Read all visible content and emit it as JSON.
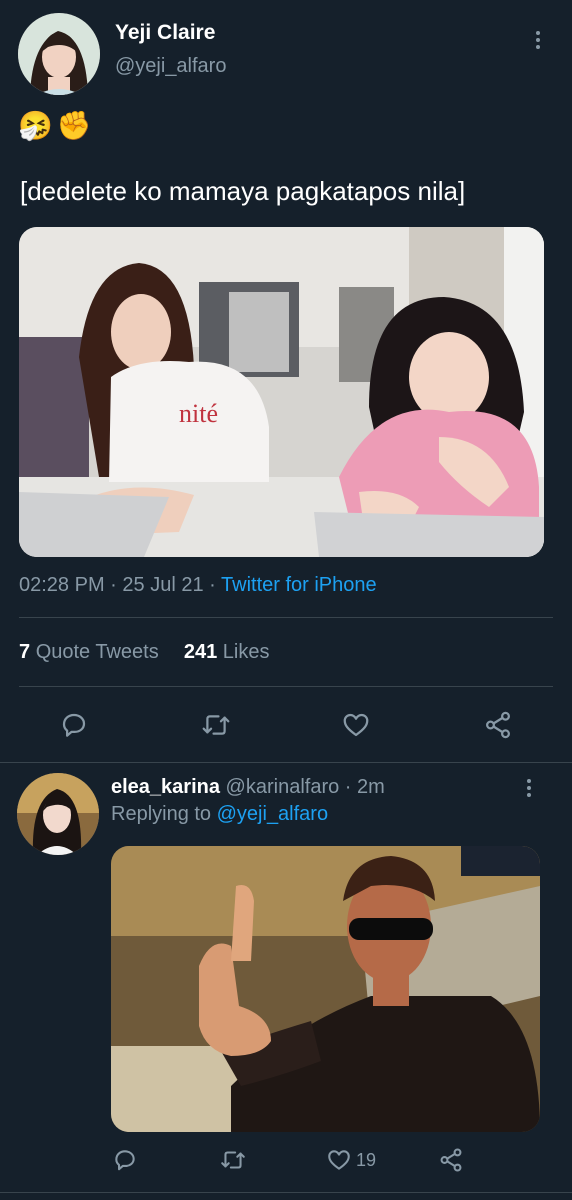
{
  "tweet": {
    "author_name": "Yeji Claire",
    "author_handle": "@yeji_alfaro",
    "emojis": "🤧✊",
    "text": "[dedelete ko mamaya pagkatapos nila]",
    "time": "02:28 PM",
    "date": "25 Jul 21",
    "separator": "·",
    "source": "Twitter for iPhone",
    "quote_count": "7",
    "quote_label": "Quote Tweets",
    "like_count": "241",
    "like_label": "Likes",
    "icons": [
      "reply-icon",
      "retweet-icon",
      "like-icon",
      "share-icon",
      "more-icon"
    ]
  },
  "reply": {
    "author_name": "elea_karina",
    "author_handle": "@karinalfaro",
    "separator": "·",
    "age": "2m",
    "replying_prefix": "Replying to",
    "replying_to": "@yeji_alfaro",
    "like_count": "19",
    "icons": [
      "reply-icon",
      "retweet-icon",
      "like-icon",
      "share-icon",
      "more-icon"
    ]
  },
  "colors": {
    "background": "#15202b",
    "text": "#ffffff",
    "muted": "#8899a6",
    "accent": "#1da1f2",
    "divider": "#38444d"
  }
}
